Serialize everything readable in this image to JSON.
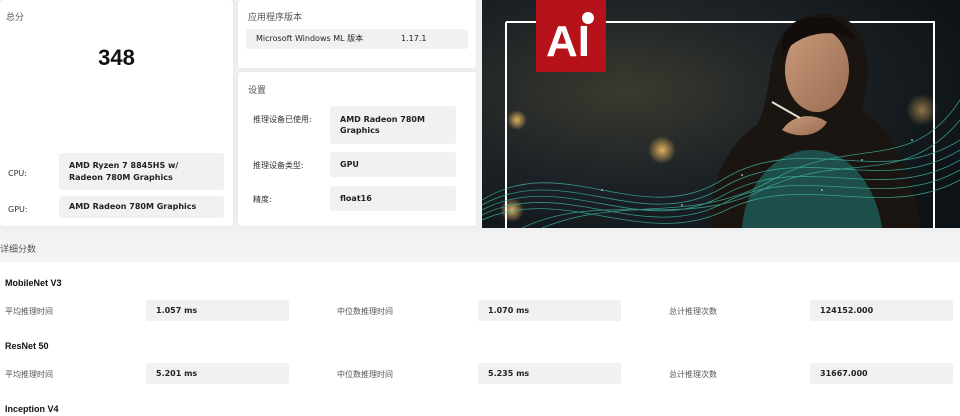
{
  "score": {
    "title": "总分",
    "value": "348",
    "cpu_label": "CPU:",
    "cpu_value": "AMD Ryzen 7 8845HS w/ Radeon 780M Graphics",
    "gpu_label": "GPU:",
    "gpu_value": "AMD Radeon 780M Graphics"
  },
  "version": {
    "title": "应用程序版本",
    "name": "Microsoft Windows ML 版本",
    "value": "1.17.1"
  },
  "settings": {
    "title": "设置",
    "rows": [
      {
        "label": "推理设备已使用:",
        "value": "AMD Radeon 780M Graphics"
      },
      {
        "label": "推理设备类型:",
        "value": "GPU"
      },
      {
        "label": "精度:",
        "value": "float16"
      }
    ]
  },
  "hero": {
    "logo_text": "AI"
  },
  "details": {
    "title": "详细分数",
    "models": [
      {
        "name": "MobileNet V3",
        "avg_label": "平均推理时间",
        "avg_value": "1.057 ms",
        "median_label": "中位数推理时间",
        "median_value": "1.070 ms",
        "total_label": "总计推理次数",
        "total_value": "124152.000"
      },
      {
        "name": "ResNet 50",
        "avg_label": "平均推理时间",
        "avg_value": "5.201 ms",
        "median_label": "中位数推理时间",
        "median_value": "5.235 ms",
        "total_label": "总计推理次数",
        "total_value": "31667.000"
      },
      {
        "name": "Inception V4"
      }
    ]
  },
  "colors": {
    "logo_red": "#b5121b",
    "wave_teal": "#3fb3a3",
    "card_bg": "#ffffff",
    "value_box_bg": "#f1f1f1"
  }
}
